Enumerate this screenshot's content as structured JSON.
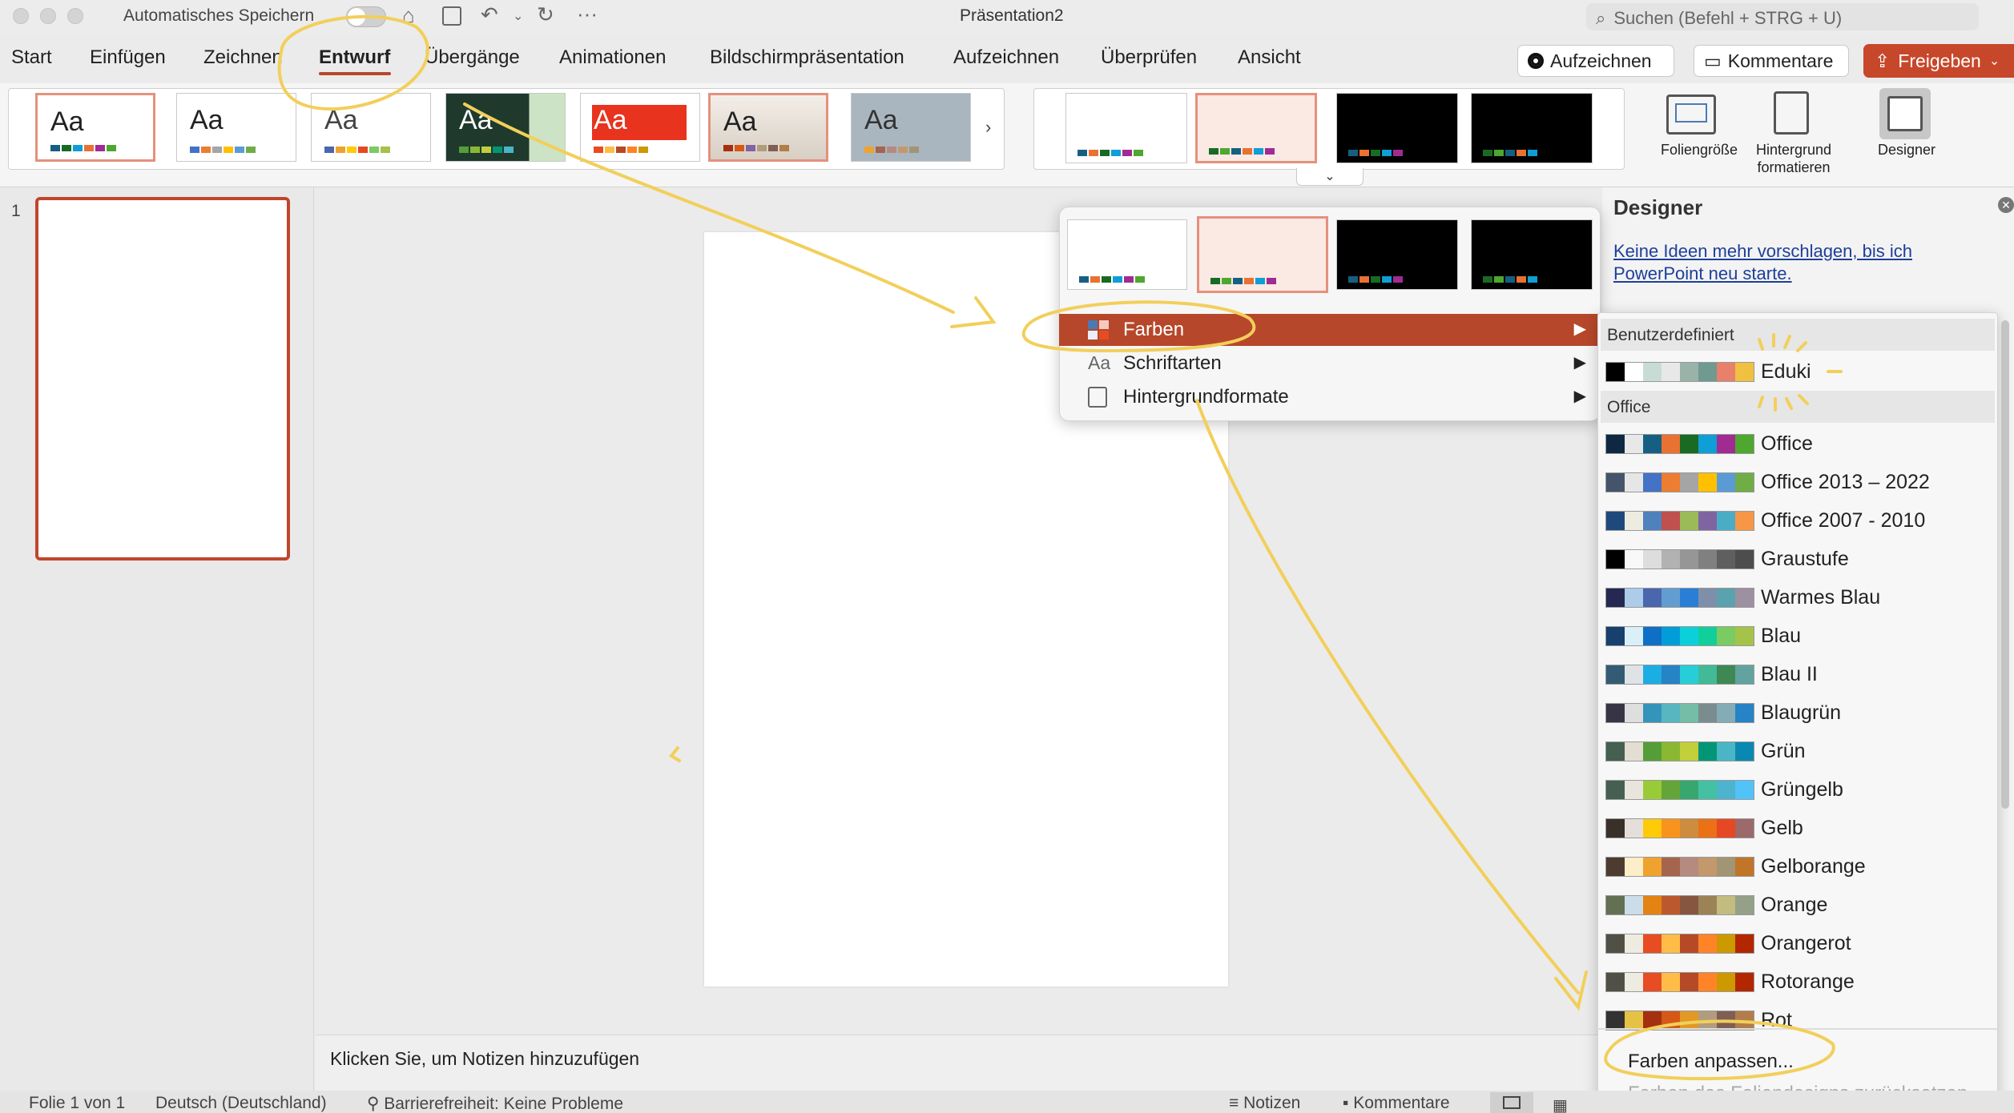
{
  "window": {
    "autosave_label": "Automatisches Speichern",
    "title": "Präsentation2",
    "search_placeholder": "Suchen (Befehl + STRG + U)"
  },
  "tabs": [
    "Start",
    "Einfügen",
    "Zeichnen",
    "Entwurf",
    "Übergänge",
    "Animationen",
    "Bildschirmpräsentation",
    "Aufzeichnen",
    "Überprüfen",
    "Ansicht"
  ],
  "active_tab": "Entwurf",
  "header_buttons": {
    "record": "Aufzeichnen",
    "comments": "Kommentare",
    "share": "Freigeben"
  },
  "ribbon": {
    "theme_sample_text": "Aa",
    "slide_size": "Foliengröße",
    "format_background_1": "Hintergrund",
    "format_background_2": "formatieren",
    "designer": "Designer"
  },
  "slide_panel": {
    "slide_number": "1"
  },
  "notes_placeholder": "Klicken Sie, um Notizen hinzuzufügen",
  "designer_pane": {
    "title": "Designer",
    "link_line1": "Keine Ideen mehr vorschlagen, bis ich",
    "link_line2": "PowerPoint neu starte."
  },
  "variants_menu": {
    "items": [
      {
        "label": "Farben",
        "icon": "colors-icon"
      },
      {
        "label": "Schriftarten",
        "icon": "fonts-icon",
        "icon_text": "Aa"
      },
      {
        "label": "Hintergrundformate",
        "icon": "background-styles-icon"
      }
    ]
  },
  "colors_submenu": {
    "section_custom": "Benutzerdefiniert",
    "section_office": "Office",
    "custom": {
      "name": "Eduki",
      "swatches": [
        "#000000",
        "#ffffff",
        "#c8dcd6",
        "#e8e8e8",
        "#9ab3a8",
        "#6f9a8f",
        "#e8806a",
        "#f0c040"
      ]
    },
    "schemes": [
      {
        "name": "Office",
        "swatches": [
          "#0e2841",
          "#e8e8e8",
          "#156082",
          "#e97132",
          "#196b24",
          "#0f9ed5",
          "#a02b93",
          "#4ea72e"
        ]
      },
      {
        "name": "Office 2013 – 2022",
        "swatches": [
          "#44546a",
          "#e7e6e6",
          "#4472c4",
          "#ed7d31",
          "#a5a5a5",
          "#ffc000",
          "#5b9bd5",
          "#70ad47"
        ]
      },
      {
        "name": "Office 2007 - 2010",
        "swatches": [
          "#1f497d",
          "#eeece1",
          "#4f81bd",
          "#c0504d",
          "#9bbb59",
          "#8064a2",
          "#4bacc6",
          "#f79646"
        ]
      },
      {
        "name": "Graustufe",
        "swatches": [
          "#000000",
          "#f8f8f8",
          "#dddddd",
          "#b2b2b2",
          "#969696",
          "#808080",
          "#5f5f5f",
          "#4d4d4d"
        ]
      },
      {
        "name": "Warmes Blau",
        "swatches": [
          "#242852",
          "#acccea",
          "#4a66ac",
          "#629dd1",
          "#297fd5",
          "#7f8fa9",
          "#5aa2ae",
          "#9d90a0"
        ]
      },
      {
        "name": "Blau",
        "swatches": [
          "#17406d",
          "#dbeff9",
          "#0f6fc6",
          "#009dd9",
          "#0bd0d9",
          "#10cf9b",
          "#7cca62",
          "#a5c249"
        ]
      },
      {
        "name": "Blau II",
        "swatches": [
          "#335b74",
          "#dfe3e5",
          "#1cade4",
          "#2683c6",
          "#27ced7",
          "#42ba97",
          "#3e8853",
          "#62a39f"
        ]
      },
      {
        "name": "Blaugrün",
        "swatches": [
          "#373545",
          "#dedede",
          "#3494ba",
          "#58b6c0",
          "#75bda7",
          "#7a8c8e",
          "#84acb6",
          "#2683c6"
        ]
      },
      {
        "name": "Grün",
        "swatches": [
          "#455f51",
          "#e3ded1",
          "#549e39",
          "#8ab833",
          "#c0cf3a",
          "#029676",
          "#4ab5c4",
          "#0989b1"
        ]
      },
      {
        "name": "Grüngelb",
        "swatches": [
          "#455f51",
          "#e9e5dc",
          "#99cb38",
          "#63a537",
          "#37a76f",
          "#44c1a3",
          "#4eb3cf",
          "#51c3f9"
        ]
      },
      {
        "name": "Gelb",
        "swatches": [
          "#39302a",
          "#e5dedb",
          "#ffca08",
          "#f8931d",
          "#ce8d3e",
          "#ec7016",
          "#e64823",
          "#9c6a6a"
        ]
      },
      {
        "name": "Gelborange",
        "swatches": [
          "#4e3b30",
          "#fbeec9",
          "#f0a22e",
          "#a5644e",
          "#b58b80",
          "#c3986d",
          "#a19574",
          "#c17529"
        ]
      },
      {
        "name": "Orange",
        "swatches": [
          "#637052",
          "#ccddea",
          "#e48312",
          "#bd582c",
          "#865640",
          "#9b8357",
          "#c2bc80",
          "#94a088"
        ]
      },
      {
        "name": "Orangerot",
        "swatches": [
          "#505046",
          "#eeece1",
          "#e84c22",
          "#ffbd47",
          "#b64926",
          "#ff8427",
          "#cc9900",
          "#b22600"
        ]
      },
      {
        "name": "Rotorange",
        "swatches": [
          "#505046",
          "#eeece1",
          "#e84c22",
          "#ffbd47",
          "#b64926",
          "#ff8427",
          "#cc9900",
          "#b22600"
        ]
      },
      {
        "name": "Rot",
        "swatches": [
          "#323232",
          "#e5c243",
          "#a5300f",
          "#d55816",
          "#e19825",
          "#b19c7d",
          "#7f5f52",
          "#b27d49"
        ]
      }
    ],
    "customize": "Farben anpassen...",
    "reset": "Farben des Foliendesigns zurücksetzen"
  },
  "status_bar": {
    "slide_info": "Folie 1 von 1",
    "language": "Deutsch (Deutschland)",
    "accessibility": "Barrierefreiheit: Keine Probleme",
    "notes": "Notizen",
    "comments": "Kommentare"
  },
  "colors": {
    "accent": "#b7472a",
    "annotation": "#f2cf5b"
  }
}
